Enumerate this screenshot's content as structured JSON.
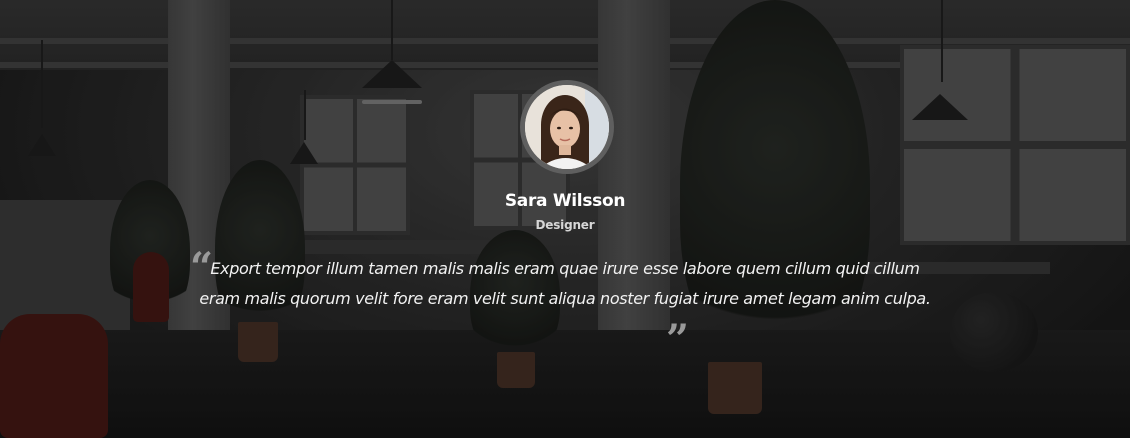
{
  "testimonial": {
    "name": "Sara Wilsson",
    "role": "Designer",
    "quote": "Export tempor illum tamen malis malis eram quae irure esse labore quem cillum quid cillum eram malis quorum velit fore eram velit sunt aliqua noster fugiat irure amet legam anim culpa.",
    "quote_open_icon": "quote-left-icon",
    "quote_close_icon": "quote-right-icon",
    "avatar": "profile-photo"
  },
  "colors": {
    "text": "#ffffff",
    "role_text": "#d6d6d6",
    "quote_icon": "#9a9a9a",
    "avatar_border": "#5f5f5f",
    "overlay": "#000000"
  }
}
